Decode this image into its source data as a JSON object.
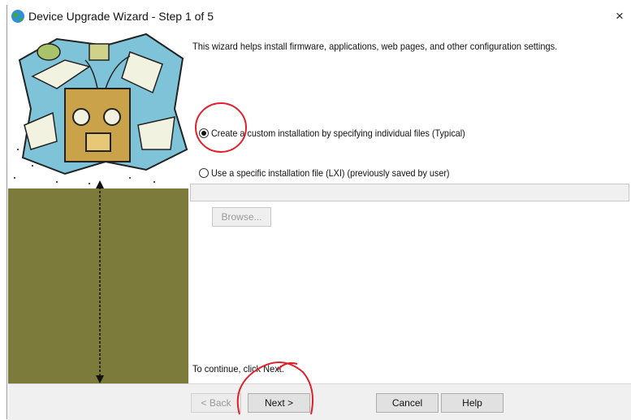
{
  "window": {
    "title": "Device Upgrade Wizard - Step 1 of 5",
    "close_glyph": "×",
    "app_icon": "globe-icon"
  },
  "sidebar": {
    "illustration": "wizard-illustration"
  },
  "main": {
    "intro": "This wizard helps install firmware, applications, web pages, and other configuration settings.",
    "options": [
      {
        "label": "Create a custom installation by specifying individual files (Typical)",
        "selected": true
      },
      {
        "label": "Use a specific installation file (LXI) (previously saved by user)",
        "selected": false
      }
    ],
    "file_value": "",
    "browse_label": "Browse...",
    "continue_text": "To continue, click Next."
  },
  "footer": {
    "back_label": "< Back",
    "next_label": "Next >",
    "cancel_label": "Cancel",
    "help_label": "Help"
  },
  "colors": {
    "sidebar_bg": "#7c7b3b",
    "annotation_red": "#e0202a"
  }
}
